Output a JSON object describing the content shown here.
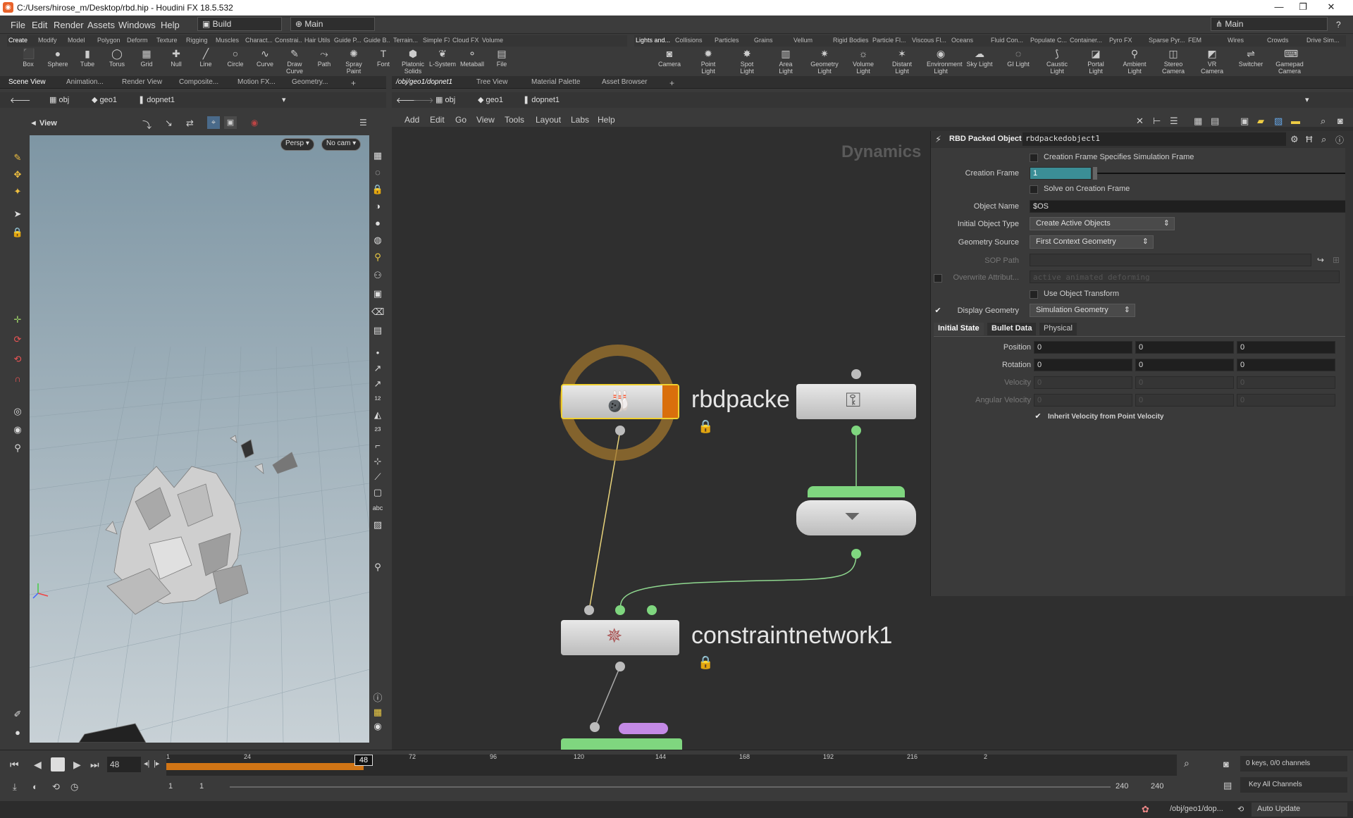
{
  "window": {
    "title": "C:/Users/hirose_m/Desktop/rbd.hip - Houdini FX 18.5.532"
  },
  "menubar": {
    "items": [
      "File",
      "Edit",
      "Render",
      "Assets",
      "Windows",
      "Help"
    ],
    "desktop": "Build",
    "network_desk": "Main",
    "right_desk": "Main"
  },
  "shelf_left": {
    "tabs": [
      "Create",
      "Modify",
      "Model",
      "Polygon",
      "Deform",
      "Texture",
      "Rigging",
      "Muscles",
      "Charact...",
      "Constrai...",
      "Hair Utils",
      "Guide P...",
      "Guide B...",
      "Terrain...",
      "Simple FX",
      "Cloud FX",
      "Volume"
    ],
    "tools": [
      {
        "label": "Box",
        "icon": "cube-icon"
      },
      {
        "label": "Sphere",
        "icon": "sphere-icon"
      },
      {
        "label": "Tube",
        "icon": "tube-icon"
      },
      {
        "label": "Torus",
        "icon": "torus-icon"
      },
      {
        "label": "Grid",
        "icon": "grid-icon"
      },
      {
        "label": "Null",
        "icon": "null-icon"
      },
      {
        "label": "Line",
        "icon": "line-icon"
      },
      {
        "label": "Circle",
        "icon": "circle-icon"
      },
      {
        "label": "Curve",
        "icon": "curve-icon"
      },
      {
        "label": "Draw Curve",
        "icon": "draw-curve-icon"
      },
      {
        "label": "Path",
        "icon": "path-icon"
      },
      {
        "label": "Spray Paint",
        "icon": "spray-icon"
      },
      {
        "label": "Font",
        "icon": "font-icon"
      },
      {
        "label": "Platonic Solids",
        "icon": "platonic-icon"
      },
      {
        "label": "L-System",
        "icon": "lsystem-icon"
      },
      {
        "label": "Metaball",
        "icon": "metaball-icon"
      },
      {
        "label": "File",
        "icon": "file-icon"
      }
    ]
  },
  "shelf_right": {
    "tabs": [
      "Lights and...",
      "Collisions",
      "Particles",
      "Grains",
      "Vellum",
      "Rigid Bodies",
      "Particle Fl...",
      "Viscous Fl...",
      "Oceans",
      "Fluid Con...",
      "Populate C...",
      "Container...",
      "Pyro FX",
      "Sparse Pyr...",
      "FEM",
      "Wires",
      "Crowds",
      "Drive Sim..."
    ],
    "tools": [
      {
        "label": "Camera",
        "icon": "camera-icon"
      },
      {
        "label": "Point Light",
        "icon": "point-light-icon"
      },
      {
        "label": "Spot Light",
        "icon": "spot-light-icon"
      },
      {
        "label": "Area Light",
        "icon": "area-light-icon"
      },
      {
        "label": "Geometry Light",
        "icon": "geometry-light-icon"
      },
      {
        "label": "Volume Light",
        "icon": "volume-light-icon"
      },
      {
        "label": "Distant Light",
        "icon": "distant-light-icon"
      },
      {
        "label": "Environment Light",
        "icon": "environment-light-icon"
      },
      {
        "label": "Sky Light",
        "icon": "sky-light-icon"
      },
      {
        "label": "GI Light",
        "icon": "gi-light-icon"
      },
      {
        "label": "Caustic Light",
        "icon": "caustic-light-icon"
      },
      {
        "label": "Portal Light",
        "icon": "portal-light-icon"
      },
      {
        "label": "Ambient Light",
        "icon": "ambient-light-icon"
      },
      {
        "label": "Stereo Camera",
        "icon": "stereo-camera-icon"
      },
      {
        "label": "VR Camera",
        "icon": "vr-camera-icon"
      },
      {
        "label": "Switcher",
        "icon": "switcher-icon"
      },
      {
        "label": "Gamepad Camera",
        "icon": "gamepad-camera-icon"
      }
    ]
  },
  "left_pane": {
    "tabs": [
      "Scene View",
      "Animation...",
      "Render View",
      "Composite...",
      "Motion FX...",
      "Geometry..."
    ],
    "path": [
      "obj",
      "geo1",
      "dopnet1"
    ],
    "view_label": "View",
    "persp": "Persp",
    "cam": "No cam"
  },
  "right_pane": {
    "tabs": [
      "/obj/geo1/dopnet1",
      "Tree View",
      "Material Palette",
      "Asset Browser"
    ],
    "path": [
      "obj",
      "geo1",
      "dopnet1"
    ],
    "menu": [
      "Add",
      "Edit",
      "Go",
      "View",
      "Tools",
      "Layout",
      "Labs",
      "Help"
    ],
    "context": "Dynamics"
  },
  "nodes": {
    "rbd": "rbdpacke",
    "constraint": "constraintnetwork1"
  },
  "params": {
    "node_type": "RBD Packed Object",
    "node_name": "rbdpackedobject1",
    "creation_frame_specifies": "Creation Frame Specifies Simulation Frame",
    "creation_frame_label": "Creation Frame",
    "creation_frame_value": "1",
    "solve_on_creation": "Solve on Creation Frame",
    "object_name_label": "Object Name",
    "object_name_value": "$OS",
    "initial_type_label": "Initial Object Type",
    "initial_type_value": "Create Active Objects",
    "geo_source_label": "Geometry Source",
    "geo_source_value": "First Context Geometry",
    "sop_path_label": "SOP Path",
    "overwrite_label": "Overwrite Attribut...",
    "overwrite_value": "active animated deforming",
    "use_obj_transform": "Use Object Transform",
    "display_geo_label": "Display Geometry",
    "display_geo_value": "Simulation Geometry",
    "tabs": [
      "Initial State",
      "Bullet Data",
      "Physical"
    ],
    "position_label": "Position",
    "position": [
      "0",
      "0",
      "0"
    ],
    "rotation_label": "Rotation",
    "rotation": [
      "0",
      "0",
      "0"
    ],
    "velocity_label": "Velocity",
    "velocity": [
      "0",
      "0",
      "0"
    ],
    "angvel_label": "Angular Velocity",
    "angvel": [
      "0",
      "0",
      "0"
    ],
    "inherit_vel": "Inherit Velocity from Point Velocity"
  },
  "timeline": {
    "frame": "48",
    "ticks": [
      "1",
      "24",
      "72",
      "96",
      "120",
      "144",
      "168",
      "192",
      "216",
      "2"
    ],
    "cursor": "48",
    "start": "1",
    "start2": "1",
    "end": "240",
    "end2": "240",
    "keys": "0 keys, 0/0 channels",
    "key_all": "Key All Channels",
    "status_path": "/obj/geo1/dop...",
    "auto_update": "Auto Update"
  }
}
